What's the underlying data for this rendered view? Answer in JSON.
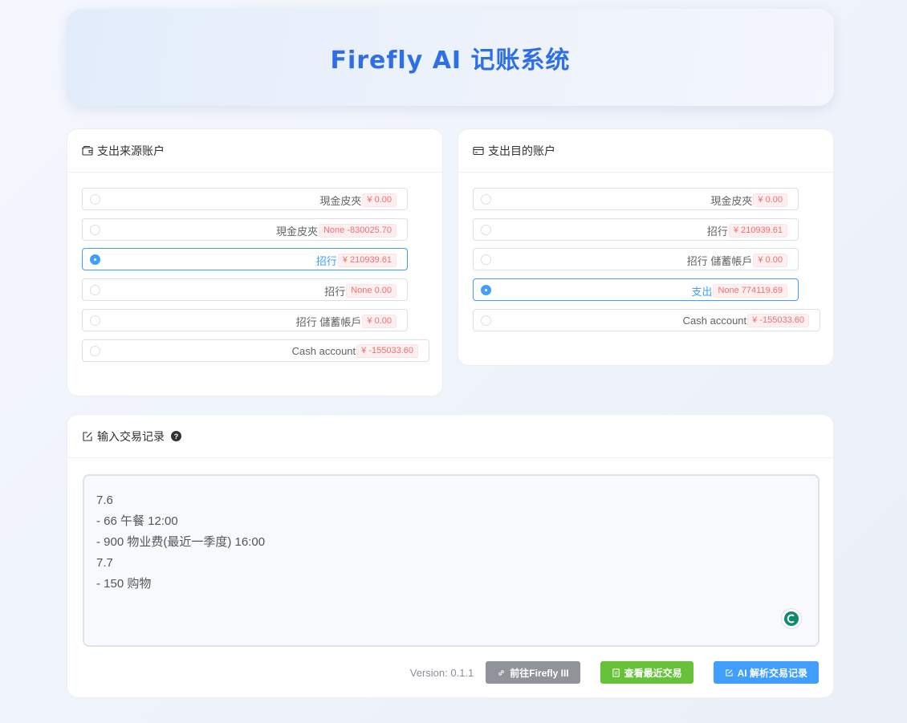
{
  "header": {
    "title": "Firefly AI 记账系统"
  },
  "source": {
    "title": "支出来源账户",
    "options": [
      {
        "name": "現金皮夾",
        "balance": "¥ 0.00"
      },
      {
        "name": "現金皮夾",
        "balance": "None -830025.70"
      },
      {
        "name": "招行",
        "balance": "¥ 210939.61",
        "selected": true
      },
      {
        "name": "招行",
        "balance": "None 0.00"
      },
      {
        "name": "招行 儲蓄帳戶",
        "balance": "¥ 0.00"
      },
      {
        "name": "Cash account",
        "balance": "¥ -155033.60"
      }
    ]
  },
  "destination": {
    "title": "支出目的账户",
    "options": [
      {
        "name": "現金皮夾",
        "balance": "¥ 0.00"
      },
      {
        "name": "招行",
        "balance": "¥ 210939.61"
      },
      {
        "name": "招行 儲蓄帳戶",
        "balance": "¥ 0.00"
      },
      {
        "name": "支出",
        "balance": "None 774119.69",
        "selected": true
      },
      {
        "name": "Cash account",
        "balance": "¥ -155033.60"
      }
    ]
  },
  "input": {
    "title": "输入交易记录",
    "help": "?",
    "lines": [
      "7.6",
      "- 66 午餐 12:00",
      "- 900 物业费(最近一季度) 16:00",
      "7.7",
      "- 150 购物"
    ]
  },
  "footer": {
    "version": "Version: 0.1.1",
    "firefly_btn": "前往Firefly III",
    "recent_btn": "查看最近交易",
    "parse_btn": "AI 解析交易记录"
  },
  "colors": {
    "accent": "#409eff",
    "title": "#2f6fe6",
    "success": "#67c23a",
    "info": "#909399",
    "danger": "#f56c6c"
  },
  "icons": {
    "source": "wallet-icon",
    "destination": "credit-card-icon",
    "input": "edit-icon"
  }
}
